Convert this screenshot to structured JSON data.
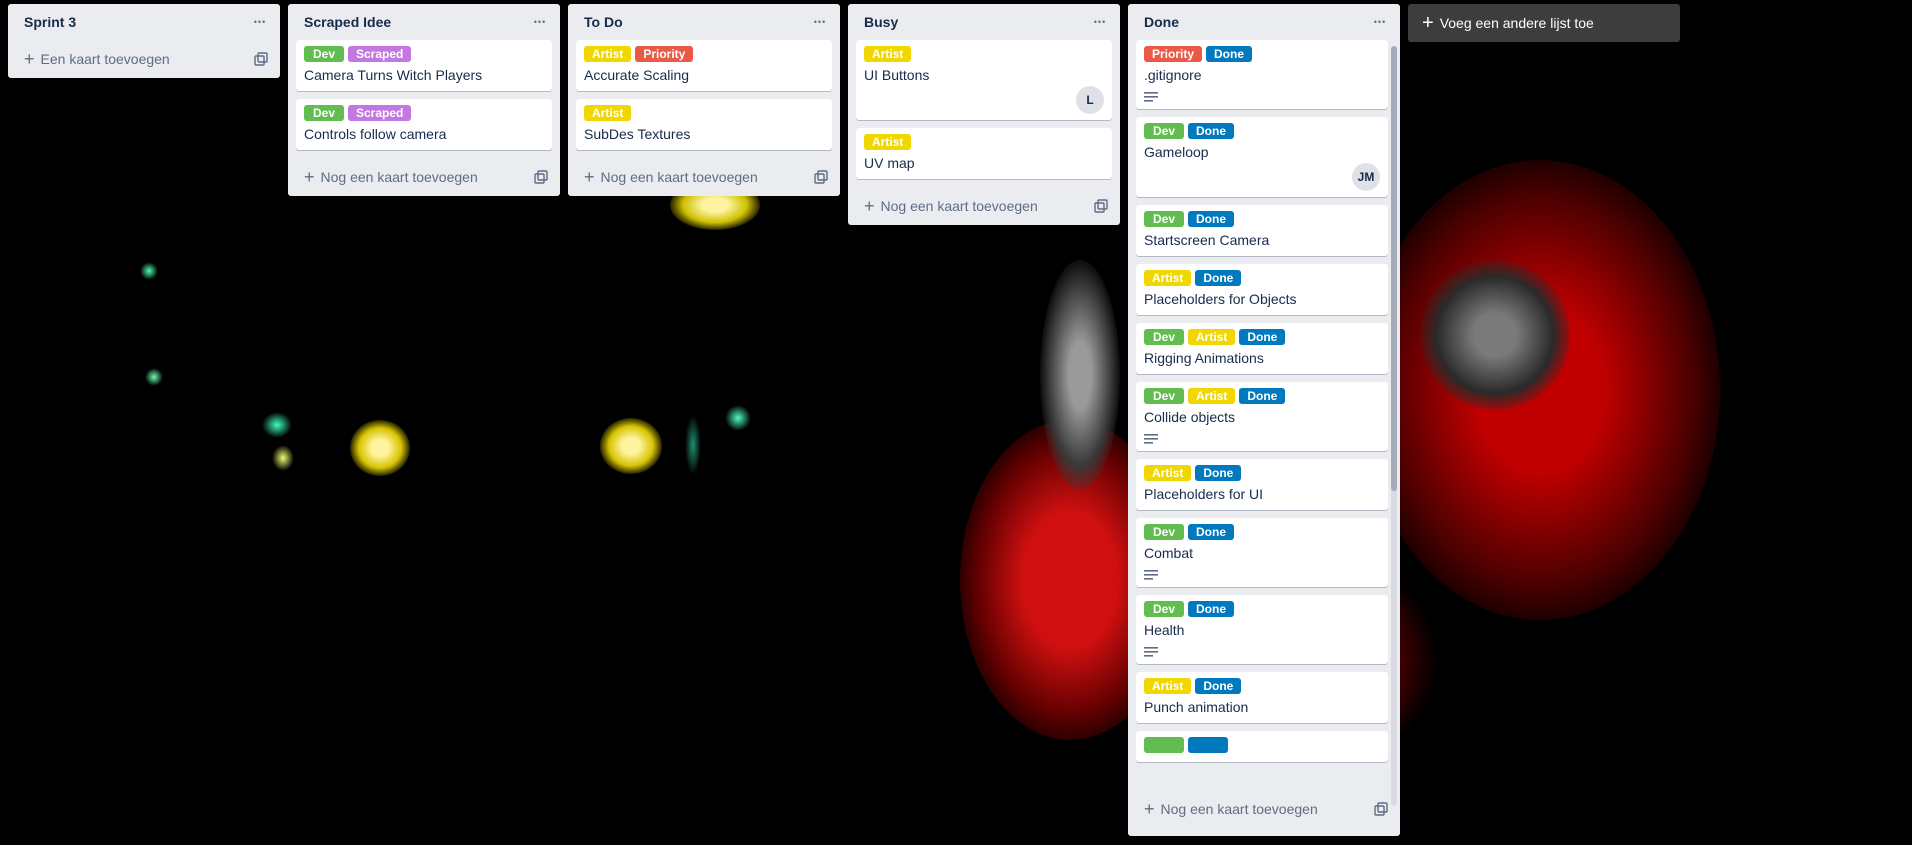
{
  "colors": {
    "dev": "#61bd4f",
    "scraped": "#c377e0",
    "artist": "#f2d600",
    "priority": "#eb5a46",
    "done": "#0079bf"
  },
  "icons": {
    "list_menu": "more-horizontal-icon",
    "add": "plus-icon",
    "template": "card-template-icon",
    "description": "description-icon"
  },
  "lists": [
    {
      "title": "Sprint 3",
      "add_label": "Een kaart toevoegen",
      "cards": []
    },
    {
      "title": "Scraped Idee",
      "add_label": "Nog een kaart toevoegen",
      "cards": [
        {
          "title": "Camera Turns Witch Players",
          "labels": [
            {
              "text": "Dev",
              "color": "dev"
            },
            {
              "text": "Scraped",
              "color": "scraped"
            }
          ]
        },
        {
          "title": "Controls follow camera",
          "labels": [
            {
              "text": "Dev",
              "color": "dev"
            },
            {
              "text": "Scraped",
              "color": "scraped"
            }
          ]
        }
      ]
    },
    {
      "title": "To Do",
      "add_label": "Nog een kaart toevoegen",
      "cards": [
        {
          "title": "Accurate Scaling",
          "labels": [
            {
              "text": "Artist",
              "color": "artist"
            },
            {
              "text": "Priority",
              "color": "priority"
            }
          ]
        },
        {
          "title": "SubDes Textures",
          "labels": [
            {
              "text": "Artist",
              "color": "artist"
            }
          ]
        }
      ]
    },
    {
      "title": "Busy",
      "add_label": "Nog een kaart toevoegen",
      "cards": [
        {
          "title": "UI Buttons",
          "labels": [
            {
              "text": "Artist",
              "color": "artist"
            }
          ],
          "avatar": "L"
        },
        {
          "title": "UV map",
          "labels": [
            {
              "text": "Artist",
              "color": "artist"
            }
          ]
        }
      ]
    },
    {
      "title": "Done",
      "add_label": "Nog een kaart toevoegen",
      "cards": [
        {
          "title": ".gitignore",
          "labels": [
            {
              "text": "Priority",
              "color": "priority"
            },
            {
              "text": "Done",
              "color": "done"
            }
          ],
          "description": true
        },
        {
          "title": "Gameloop",
          "labels": [
            {
              "text": "Dev",
              "color": "dev"
            },
            {
              "text": "Done",
              "color": "done"
            }
          ],
          "avatar": "JM"
        },
        {
          "title": "Startscreen Camera",
          "labels": [
            {
              "text": "Dev",
              "color": "dev"
            },
            {
              "text": "Done",
              "color": "done"
            }
          ]
        },
        {
          "title": "Placeholders for Objects",
          "labels": [
            {
              "text": "Artist",
              "color": "artist"
            },
            {
              "text": "Done",
              "color": "done"
            }
          ]
        },
        {
          "title": "Rigging Animations",
          "labels": [
            {
              "text": "Dev",
              "color": "dev"
            },
            {
              "text": "Artist",
              "color": "artist"
            },
            {
              "text": "Done",
              "color": "done"
            }
          ]
        },
        {
          "title": "Collide objects",
          "labels": [
            {
              "text": "Dev",
              "color": "dev"
            },
            {
              "text": "Artist",
              "color": "artist"
            },
            {
              "text": "Done",
              "color": "done"
            }
          ],
          "description": true
        },
        {
          "title": "Placeholders for UI",
          "labels": [
            {
              "text": "Artist",
              "color": "artist"
            },
            {
              "text": "Done",
              "color": "done"
            }
          ]
        },
        {
          "title": "Combat",
          "labels": [
            {
              "text": "Dev",
              "color": "dev"
            },
            {
              "text": "Done",
              "color": "done"
            }
          ],
          "description": true
        },
        {
          "title": "Health",
          "labels": [
            {
              "text": "Dev",
              "color": "dev"
            },
            {
              "text": "Done",
              "color": "done"
            }
          ],
          "description": true
        },
        {
          "title": "Punch animation",
          "labels": [
            {
              "text": "Artist",
              "color": "artist"
            },
            {
              "text": "Done",
              "color": "done"
            }
          ]
        },
        {
          "title": "",
          "labels": [
            {
              "text": "",
              "color": "dev"
            },
            {
              "text": "",
              "color": "done"
            }
          ]
        }
      ]
    }
  ],
  "add_list_label": "Voeg een andere lijst toe"
}
